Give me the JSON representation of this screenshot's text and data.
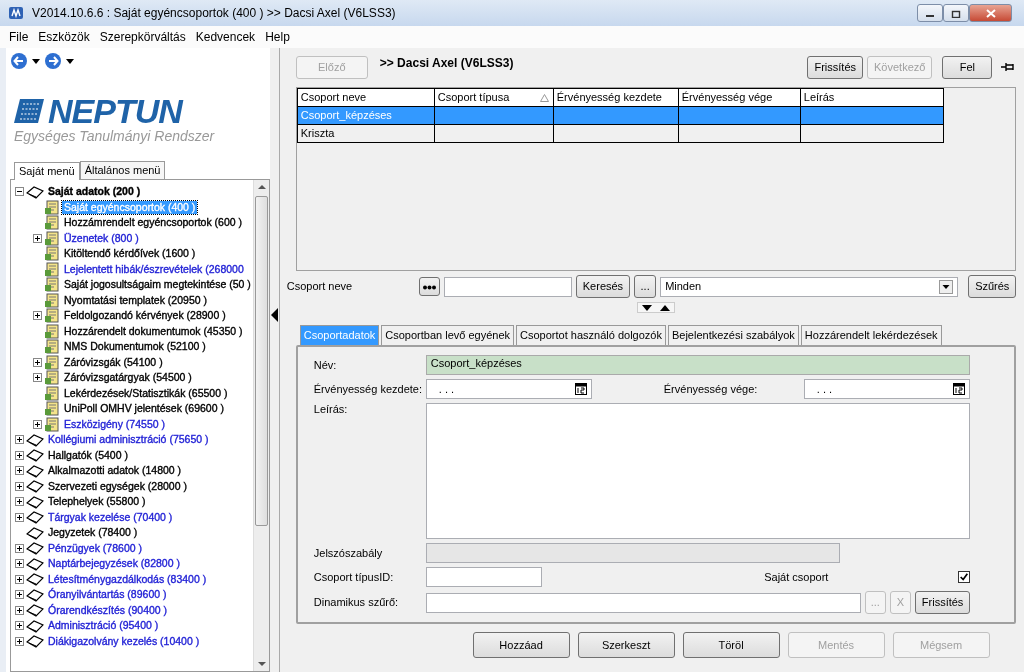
{
  "window": {
    "title": "V2014.10.6.6 : Saját egyéncsoportok (400  )  >> Dacsi Axel (V6LSS3)"
  },
  "menu": [
    "File",
    "Eszközök",
    "Szerepkörváltás",
    "Kedvencek",
    "Help"
  ],
  "logo": {
    "name": "NEPTUN",
    "tagline": "Egységes Tanulmányi Rendszer"
  },
  "menu_tabs": [
    {
      "label": "Saját menü",
      "selected": true
    },
    {
      "label": "Általános menü",
      "selected": false
    }
  ],
  "tree": [
    {
      "label": "Saját adatok (200 )",
      "kind": "folder",
      "expanded": true,
      "selected": false,
      "color": "#000000",
      "children": [
        {
          "label": "Saját egyéncsoportok (400  )",
          "kind": "document",
          "selected": true
        },
        {
          "label": "Hozzámrendelt egyéncsoportok (600 )",
          "kind": "document",
          "selected": false,
          "color": "#000000"
        },
        {
          "label": "Üzenetek (800 )",
          "kind": "document",
          "expanded": false,
          "selected": false,
          "color": "#2323d6"
        },
        {
          "label": "Kitöltendő kérdőívek (1600 )",
          "kind": "document",
          "selected": false,
          "color": "#000000"
        },
        {
          "label": "Lejelentett hibák/észrevételek (268000",
          "kind": "document",
          "selected": false,
          "color": "#2323d6"
        },
        {
          "label": "Saját jogosultságaim megtekintése (50 )",
          "kind": "document",
          "selected": false,
          "color": "#000000"
        },
        {
          "label": "Nyomtatási templatek (20950 )",
          "kind": "document",
          "selected": false,
          "color": "#000000"
        },
        {
          "label": "Feldolgozandó kérvények (28900 )",
          "kind": "document",
          "expanded": false,
          "selected": false,
          "color": "#000000"
        },
        {
          "label": "Hozzárendelt dokumentumok (45350 )",
          "kind": "document",
          "selected": false,
          "color": "#000000"
        },
        {
          "label": "NMS Dokumentumok (52100 )",
          "kind": "document",
          "selected": false,
          "color": "#000000"
        },
        {
          "label": "Záróvizsgák (54100 )",
          "kind": "document",
          "expanded": false,
          "selected": false,
          "color": "#000000"
        },
        {
          "label": "Záróvizsgatárgyak (54500 )",
          "kind": "document",
          "expanded": false,
          "selected": false,
          "color": "#000000"
        },
        {
          "label": "Lekérdezések/Statisztikák  (65500 )",
          "kind": "document",
          "selected": false,
          "color": "#000000"
        },
        {
          "label": "UniPoll OMHV jelentések (69600 )",
          "kind": "document",
          "selected": false,
          "color": "#000000"
        },
        {
          "label": "Eszközigény (74550 )",
          "kind": "document",
          "expanded": false,
          "selected": false,
          "color": "#2323d6"
        }
      ]
    },
    {
      "label": "Kollégiumi adminisztráció (75650 )",
      "kind": "folder",
      "expanded": false,
      "selected": false,
      "color": "#2323d6"
    },
    {
      "label": "Hallgatók (5400 )",
      "kind": "folder",
      "expanded": false,
      "selected": false,
      "color": "#000000"
    },
    {
      "label": "Alkalmazotti adatok (14800 )",
      "kind": "folder",
      "expanded": false,
      "selected": false,
      "color": "#000000"
    },
    {
      "label": "Szervezeti egységek (28000 )",
      "kind": "folder",
      "expanded": false,
      "selected": false,
      "color": "#000000"
    },
    {
      "label": "Telephelyek (55800 )",
      "kind": "folder",
      "expanded": false,
      "selected": false,
      "color": "#000000"
    },
    {
      "label": "Tárgyak kezelése (70400 )",
      "kind": "folder",
      "expanded": false,
      "selected": false,
      "color": "#2323d6"
    },
    {
      "label": "Jegyzetek (78400 )",
      "kind": "folder",
      "selected": false,
      "color": "#000000"
    },
    {
      "label": "Pénzügyek (78600 )",
      "kind": "folder",
      "expanded": false,
      "selected": false,
      "color": "#2323d6"
    },
    {
      "label": "Naptárbejegyzések (82800 )",
      "kind": "folder",
      "expanded": false,
      "selected": false,
      "color": "#2323d6"
    },
    {
      "label": "Létesítménygazdálkodás (83400 )",
      "kind": "folder",
      "expanded": false,
      "selected": false,
      "color": "#2323d6"
    },
    {
      "label": "Óranyilvántartás (89600 )",
      "kind": "folder",
      "expanded": false,
      "selected": false,
      "color": "#2323d6"
    },
    {
      "label": "Órarendkészítés (90400 )",
      "kind": "folder",
      "expanded": false,
      "selected": false,
      "color": "#2323d6"
    },
    {
      "label": "Adminisztráció (95400 )",
      "kind": "folder",
      "expanded": false,
      "selected": false,
      "color": "#2323d6"
    },
    {
      "label": "Diákigazolvány kezelés (10400 )",
      "kind": "folder",
      "expanded": false,
      "selected": false,
      "color": "#2323d6"
    }
  ],
  "toolbar": {
    "prev": {
      "label": "Előző",
      "disabled": true
    },
    "heading": ">> Dacsi Axel (V6LSS3)",
    "refresh": {
      "label": "Frissítés",
      "disabled": false
    },
    "next": {
      "label": "Következő",
      "disabled": true
    },
    "up": {
      "label": "Fel",
      "disabled": false
    }
  },
  "table": {
    "columns": [
      {
        "label": "Csoport neve",
        "sorted": false
      },
      {
        "label": "Csoport típusa",
        "sorted": true
      },
      {
        "label": "Érvényesség kezdete",
        "sorted": false
      },
      {
        "label": "Érvényesség vége",
        "sorted": false
      },
      {
        "label": "Leírás",
        "sorted": false
      }
    ],
    "rows": [
      {
        "name": "Csoport_képzéses",
        "selected": true
      },
      {
        "name": "Kriszta",
        "selected": false
      }
    ]
  },
  "filter": {
    "label": "Csoport neve",
    "search_button": "Keresés",
    "more_button": "...",
    "select_value": "Minden",
    "filter_button": "Szűrés"
  },
  "detail_tabs": [
    {
      "label": "Csoportadatok",
      "selected": true
    },
    {
      "label": "Csoportban levő egyének",
      "selected": false
    },
    {
      "label": "Csoportot használó dolgozók",
      "selected": false
    },
    {
      "label": "Bejelentkezési szabályok",
      "selected": false
    },
    {
      "label": "Hozzárendelt lekérdezések",
      "selected": false
    }
  ],
  "form": {
    "name": {
      "label": "Név:",
      "value": "Csoport_képzéses"
    },
    "valid_from": {
      "label": "Érvényesség kezdete:",
      "value": ". . ."
    },
    "valid_to": {
      "label": "Érvényesség vége:",
      "value": ". . ."
    },
    "description": {
      "label": "Leírás:"
    },
    "password_rule": {
      "label": "Jelszószabály"
    },
    "type_id": {
      "label": "Csoport típusID:"
    },
    "own_group": {
      "label": "Saját csoport",
      "checked": true
    },
    "dynamic_filter": {
      "label": "Dinamikus szűrő:",
      "buttons": [
        {
          "label": "...",
          "disabled": true
        },
        {
          "label": "X",
          "disabled": true
        },
        {
          "label": "Frissítés",
          "disabled": false
        }
      ]
    }
  },
  "actions": [
    {
      "label": "Hozzáad",
      "disabled": false
    },
    {
      "label": "Szerkeszt",
      "disabled": false
    },
    {
      "label": "Töröl",
      "disabled": false
    },
    {
      "label": "Mentés",
      "disabled": true
    },
    {
      "label": "Mégsem",
      "disabled": true
    }
  ]
}
